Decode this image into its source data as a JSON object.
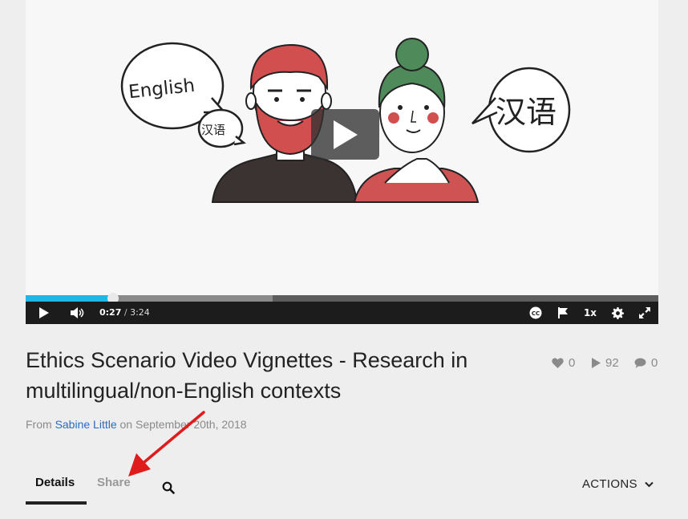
{
  "video": {
    "bubble_left_main": "English",
    "bubble_left_small": "汉语",
    "bubble_right": "汉语",
    "progress_played_fraction": 0.138,
    "progress_buffered_fraction": 0.39
  },
  "controls": {
    "current_time": "0:27",
    "separator": " / ",
    "duration": "3:24",
    "speed": "1x",
    "icons": [
      "play-icon",
      "volume-icon",
      "closed-captions-icon",
      "flag-icon",
      "settings-gear-icon",
      "fullscreen-icon"
    ]
  },
  "title": "Ethics Scenario Video Vignettes - Research in multilingual/non-English contexts",
  "stats": {
    "likes": "0",
    "plays": "92",
    "comments": "0"
  },
  "byline": {
    "prefix": "From ",
    "author": "Sabine Little",
    "suffix": " on September 20th, 2018"
  },
  "tabs": {
    "details": "Details",
    "share": "Share"
  },
  "actions_label": "ACTIONS",
  "colors": {
    "progress_played": "#1fb8e6",
    "author_link": "#2b6cc0",
    "annotation_arrow": "#e01b1b"
  }
}
